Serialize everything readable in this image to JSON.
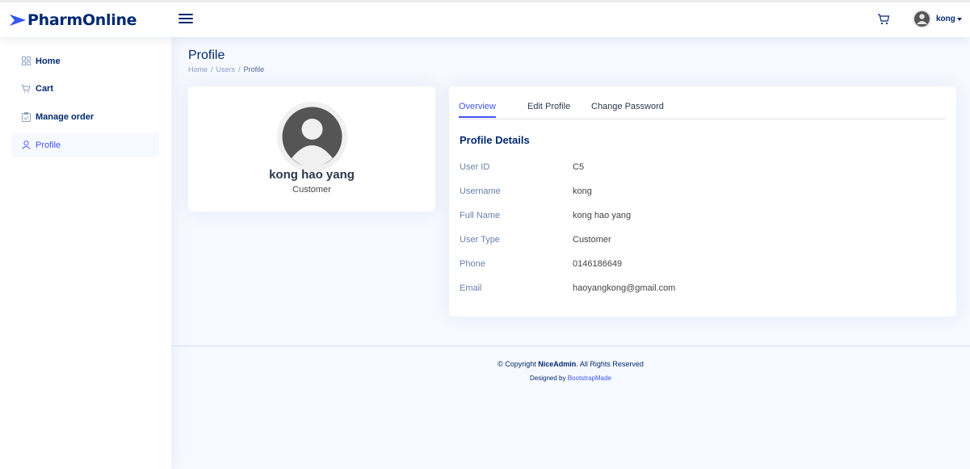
{
  "header": {
    "logo_text": "PharmOnline",
    "user_name": "kong",
    "icons": {
      "logo": "logo-arrow-icon",
      "menu": "hamburger-menu-icon",
      "cart": "cart-icon",
      "avatar": "user-avatar-icon",
      "caret": "caret-down-icon"
    }
  },
  "sidebar": {
    "items": [
      {
        "label": "Home",
        "icon": "grid-icon"
      },
      {
        "label": "Cart",
        "icon": "cart-icon"
      },
      {
        "label": "Manage order",
        "icon": "clipboard-icon"
      },
      {
        "label": "Profile",
        "icon": "person-icon",
        "active": true
      }
    ]
  },
  "main": {
    "title": "Profile",
    "breadcrumb": {
      "home": "Home",
      "users": "Users",
      "current": "Profile",
      "separator": "/"
    }
  },
  "profile_card": {
    "name": "kong hao yang",
    "role": "Customer"
  },
  "details_card": {
    "tabs": [
      {
        "label": "Overview",
        "active": true
      },
      {
        "label": "Edit Profile"
      },
      {
        "label": "Change Password"
      }
    ],
    "section_title": "Profile Details",
    "rows": [
      {
        "label": "User ID",
        "value": "C5"
      },
      {
        "label": "Username",
        "value": "kong"
      },
      {
        "label": "Full Name",
        "value": "kong hao yang"
      },
      {
        "label": "User Type",
        "value": "Customer"
      },
      {
        "label": "Phone",
        "value": "0146186649"
      },
      {
        "label": "Email",
        "value": "haoyangkong@gmail.com"
      }
    ]
  },
  "footer": {
    "copyright_prefix": "© Copyright",
    "brand": "NiceAdmin",
    "copyright_suffix": ". All Rights Reserved",
    "designed_prefix": "Designed by",
    "designed_link": "BootstrapMade"
  },
  "colors": {
    "primary": "#4154f1",
    "navy": "#012970",
    "background": "#f6f9ff",
    "logo_accent": "#4154f1"
  }
}
